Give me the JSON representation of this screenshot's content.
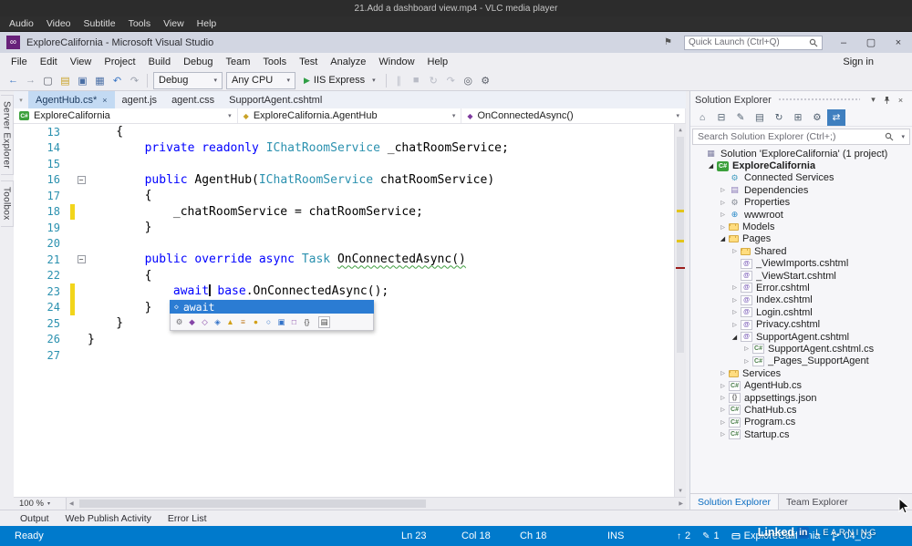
{
  "vlc": {
    "title": "21.Add a dashboard view.mp4 - VLC media player",
    "menu": [
      "Audio",
      "Video",
      "Subtitle",
      "Tools",
      "View",
      "Help"
    ]
  },
  "watermark": {
    "brand": "Linked",
    "brand_in": "in",
    "suffix": "LEARNING"
  },
  "vs": {
    "title": "ExploreCalifornia - Microsoft Visual Studio",
    "sign_in": "Sign in",
    "quick_launch_placeholder": "Quick Launch (Ctrl+Q)",
    "window_buttons": {
      "minimize": "–",
      "restore": "▢",
      "close": "×"
    },
    "menu": [
      "File",
      "Edit",
      "View",
      "Project",
      "Build",
      "Debug",
      "Team",
      "Tools",
      "Test",
      "Analyze",
      "Window",
      "Help"
    ],
    "toolbar": {
      "left_icons": [
        {
          "name": "navigate-back-icon",
          "glyph": "←",
          "color": "#3a76c4"
        },
        {
          "name": "navigate-forward-icon",
          "glyph": "→",
          "color": "#9aa0ac"
        },
        {
          "name": "new-project-icon",
          "glyph": "▢",
          "color": "#5a5e68"
        },
        {
          "name": "open-file-icon",
          "glyph": "▤",
          "color": "#c9a227"
        },
        {
          "name": "save-icon",
          "glyph": "▣",
          "color": "#4a6fa5"
        },
        {
          "name": "save-all-icon",
          "glyph": "▦",
          "color": "#4a6fa5"
        },
        {
          "name": "undo-icon",
          "glyph": "↶",
          "color": "#3a76c4"
        },
        {
          "name": "redo-icon",
          "glyph": "↷",
          "color": "#9aa0ac"
        }
      ],
      "config_value": "Debug",
      "platform_value": "Any CPU",
      "run_label": "IIS Express",
      "right_icons": [
        {
          "name": "break-all-icon",
          "glyph": "∥",
          "color": "#b9bcc6"
        },
        {
          "name": "stop-debugging-icon",
          "glyph": "■",
          "color": "#b9bcc6"
        },
        {
          "name": "restart-icon",
          "glyph": "↻",
          "color": "#b9bcc6"
        },
        {
          "name": "step-over-icon",
          "glyph": "↷",
          "color": "#b9bcc6"
        },
        {
          "name": "find-icon",
          "glyph": "◎",
          "color": "#5a5e68"
        },
        {
          "name": "options-icon",
          "glyph": "⚙",
          "color": "#5a5e68"
        }
      ]
    },
    "side_tabs": [
      "Server Explorer",
      "Toolbox"
    ],
    "doc_tabs": [
      {
        "label": "AgentHub.cs*",
        "active": true
      },
      {
        "label": "agent.js",
        "active": false
      },
      {
        "label": "agent.css",
        "active": false
      },
      {
        "label": "SupportAgent.cshtml",
        "active": false
      }
    ],
    "breadcrumbs": [
      "ExploreCalifornia",
      "ExploreCalifornia.AgentHub",
      "OnConnectedAsync()"
    ],
    "editor": {
      "zoom": "100 %",
      "lines": [
        {
          "n": 13,
          "i": 4,
          "t": [
            [
              "pl",
              "{"
            ]
          ]
        },
        {
          "n": 14,
          "i": 8,
          "t": [
            [
              "kw",
              "private"
            ],
            [
              "pl",
              " "
            ],
            [
              "kw",
              "readonly"
            ],
            [
              "pl",
              " "
            ],
            [
              "ty",
              "IChatRoomService"
            ],
            [
              "pl",
              " _chatRoomService;"
            ]
          ]
        },
        {
          "n": 15,
          "i": 0,
          "t": []
        },
        {
          "n": 16,
          "i": 8,
          "fold": true,
          "t": [
            [
              "kw",
              "public"
            ],
            [
              "pl",
              " AgentHub("
            ],
            [
              "ty",
              "IChatRoomService"
            ],
            [
              "pl",
              " chatRoomService)"
            ]
          ]
        },
        {
          "n": 17,
          "i": 8,
          "t": [
            [
              "pl",
              "{"
            ]
          ]
        },
        {
          "n": 18,
          "i": 12,
          "chg": true,
          "t": [
            [
              "pl",
              "_chatRoomService = chatRoomService;"
            ]
          ]
        },
        {
          "n": 19,
          "i": 8,
          "t": [
            [
              "pl",
              "}"
            ]
          ]
        },
        {
          "n": 20,
          "i": 0,
          "t": []
        },
        {
          "n": 21,
          "i": 8,
          "fold": true,
          "t": [
            [
              "kw",
              "public"
            ],
            [
              "pl",
              " "
            ],
            [
              "kw",
              "override"
            ],
            [
              "pl",
              " "
            ],
            [
              "kw",
              "async"
            ],
            [
              "pl",
              " "
            ],
            [
              "ty",
              "Task"
            ],
            [
              "pl",
              " "
            ],
            [
              "warn",
              "OnConnectedAsync()"
            ]
          ]
        },
        {
          "n": 22,
          "i": 8,
          "t": [
            [
              "pl",
              "{"
            ]
          ]
        },
        {
          "n": 23,
          "i": 12,
          "chg": true,
          "t": [
            [
              "kw",
              "await"
            ],
            [
              "caret",
              ""
            ],
            [
              "pl",
              " "
            ],
            [
              "kw",
              "base"
            ],
            [
              "pl",
              ".OnConnectedAsync();"
            ]
          ]
        },
        {
          "n": 24,
          "i": 8,
          "chg": true,
          "t": [
            [
              "pl",
              "}"
            ]
          ]
        },
        {
          "n": 25,
          "i": 4,
          "t": [
            [
              "pl",
              "}"
            ]
          ]
        },
        {
          "n": 26,
          "i": 0,
          "t": [
            [
              "pl",
              "}"
            ]
          ]
        },
        {
          "n": 27,
          "i": 0,
          "t": []
        }
      ],
      "completion": {
        "selected_label": "await",
        "filters": [
          {
            "name": "filter-properties-icon",
            "glyph": "⚙",
            "color": "#6d6d72"
          },
          {
            "name": "filter-methods-icon",
            "glyph": "◆",
            "color": "#8646a8"
          },
          {
            "name": "filter-extension-methods-icon",
            "glyph": "◇",
            "color": "#8646a8"
          },
          {
            "name": "filter-fields-icon",
            "glyph": "◈",
            "color": "#3272c8"
          },
          {
            "name": "filter-events-icon",
            "glyph": "▲",
            "color": "#d2a018"
          },
          {
            "name": "filter-enums-icon",
            "glyph": "≡",
            "color": "#c07b1e"
          },
          {
            "name": "filter-classes-icon",
            "glyph": "●",
            "color": "#d2a018"
          },
          {
            "name": "filter-interfaces-icon",
            "glyph": "○",
            "color": "#3272c8"
          },
          {
            "name": "filter-structs-icon",
            "glyph": "▣",
            "color": "#3272c8"
          },
          {
            "name": "filter-delegates-icon",
            "glyph": "□",
            "color": "#8646a8"
          },
          {
            "name": "filter-keywords-icon",
            "glyph": "{}",
            "color": "#444444"
          },
          {
            "name": "filter-snippets-icon",
            "glyph": "▤",
            "color": "#444444"
          }
        ]
      }
    },
    "solution_explorer": {
      "title": "Solution Explorer",
      "search_placeholder": "Search Solution Explorer (Ctrl+;)",
      "toolbar_icons": [
        {
          "name": "home-icon",
          "glyph": "⌂",
          "color": "#4a5a6a"
        },
        {
          "name": "collapse-all-icon",
          "glyph": "⊟",
          "color": "#4a5a6a"
        },
        {
          "name": "pending-changes-filter-icon",
          "glyph": "✎",
          "color": "#4a5a6a"
        },
        {
          "name": "show-all-files-icon",
          "glyph": "▤",
          "color": "#4a5a6a"
        },
        {
          "name": "refresh-icon",
          "glyph": "↻",
          "color": "#4a5a6a"
        },
        {
          "name": "collapse-icon",
          "glyph": "⊞",
          "color": "#4a5a6a"
        },
        {
          "name": "properties-icon",
          "glyph": "⚙",
          "color": "#4a5a6a"
        },
        {
          "name": "sync-with-active-document-icon",
          "glyph": "⇄",
          "color": "#ffffff",
          "active": true
        }
      ],
      "tree": [
        {
          "label": "Solution 'ExploreCalifornia' (1 project)",
          "depth": 0,
          "icon": "solution-icon"
        },
        {
          "label": "ExploreCalifornia",
          "depth": 1,
          "icon": "csproj-icon",
          "exp": "open",
          "bold": true
        },
        {
          "label": "Connected Services",
          "depth": 2,
          "icon": "connected-services-icon"
        },
        {
          "label": "Dependencies",
          "depth": 2,
          "icon": "dependencies-icon",
          "exp": "closed"
        },
        {
          "label": "Properties",
          "depth": 2,
          "icon": "properties-folder-icon",
          "exp": "closed"
        },
        {
          "label": "wwwroot",
          "depth": 2,
          "icon": "wwwroot-icon",
          "exp": "closed"
        },
        {
          "label": "Models",
          "depth": 2,
          "icon": "folder-icon",
          "exp": "closed"
        },
        {
          "label": "Pages",
          "depth": 2,
          "icon": "folder-open-icon",
          "exp": "open"
        },
        {
          "label": "Shared",
          "depth": 3,
          "icon": "folder-icon",
          "exp": "closed"
        },
        {
          "label": "_ViewImports.cshtml",
          "depth": 3,
          "icon": "razor-icon"
        },
        {
          "label": "_ViewStart.cshtml",
          "depth": 3,
          "icon": "razor-icon"
        },
        {
          "label": "Error.cshtml",
          "depth": 3,
          "icon": "razor-icon",
          "exp": "closed"
        },
        {
          "label": "Index.cshtml",
          "depth": 3,
          "icon": "razor-icon",
          "exp": "closed"
        },
        {
          "label": "Login.cshtml",
          "depth": 3,
          "icon": "razor-icon",
          "exp": "closed"
        },
        {
          "label": "Privacy.cshtml",
          "depth": 3,
          "icon": "razor-icon",
          "exp": "closed"
        },
        {
          "label": "SupportAgent.cshtml",
          "depth": 3,
          "icon": "razor-icon",
          "exp": "open"
        },
        {
          "label": "SupportAgent.cshtml.cs",
          "depth": 4,
          "icon": "cs-icon",
          "exp": "closed"
        },
        {
          "label": "_Pages_SupportAgent",
          "depth": 4,
          "icon": "cs-icon",
          "exp": "closed"
        },
        {
          "label": "Services",
          "depth": 2,
          "icon": "folder-icon",
          "exp": "closed"
        },
        {
          "label": "AgentHub.cs",
          "depth": 2,
          "icon": "cs-icon",
          "exp": "closed"
        },
        {
          "label": "appsettings.json",
          "depth": 2,
          "icon": "json-icon",
          "exp": "closed"
        },
        {
          "label": "ChatHub.cs",
          "depth": 2,
          "icon": "cs-icon",
          "exp": "closed"
        },
        {
          "label": "Program.cs",
          "depth": 2,
          "icon": "cs-icon",
          "exp": "closed"
        },
        {
          "label": "Startup.cs",
          "depth": 2,
          "icon": "cs-icon",
          "exp": "closed"
        }
      ],
      "bottom_tabs": [
        {
          "label": "Solution Explorer",
          "active": true
        },
        {
          "label": "Team Explorer",
          "active": false
        }
      ]
    },
    "panel_tabs": [
      "Output",
      "Web Publish Activity",
      "Error List"
    ],
    "status_bar": {
      "state": "Ready",
      "ln": "Ln 23",
      "col": "Col 18",
      "ch": "Ch 18",
      "mode": "INS",
      "ahead_count": "2",
      "edits_count": "1",
      "repo": "ExploreCalifornia",
      "branch": "04_03"
    }
  }
}
